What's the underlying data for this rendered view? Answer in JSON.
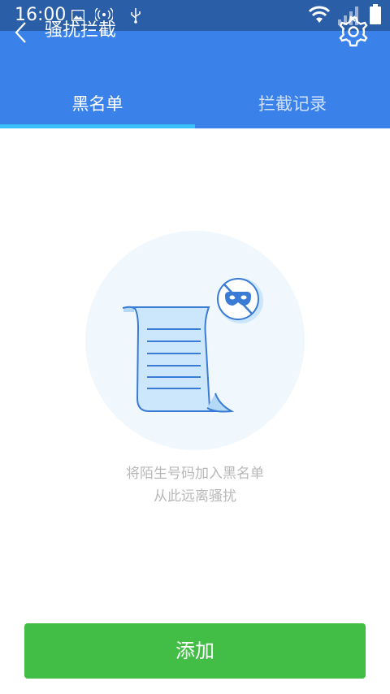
{
  "status_bar": {
    "time": "16:00"
  },
  "toolbar": {
    "title": "骚扰拦截"
  },
  "tabs": [
    {
      "label": "黑名单",
      "active": true
    },
    {
      "label": "拦截记录",
      "active": false
    }
  ],
  "empty_state": {
    "line1": "将陌生号码加入黑名单",
    "line2": "从此远离骚扰"
  },
  "add_button": {
    "label": "添加"
  },
  "colors": {
    "header": "#3a82ea",
    "status_bar": "#2a5fa8",
    "tab_indicator": "#39c0ff",
    "add_button": "#42bd45"
  },
  "icons": {
    "back": "back-icon",
    "settings": "settings-gear-icon",
    "illustration": "blocked-list-scroll-icon"
  }
}
